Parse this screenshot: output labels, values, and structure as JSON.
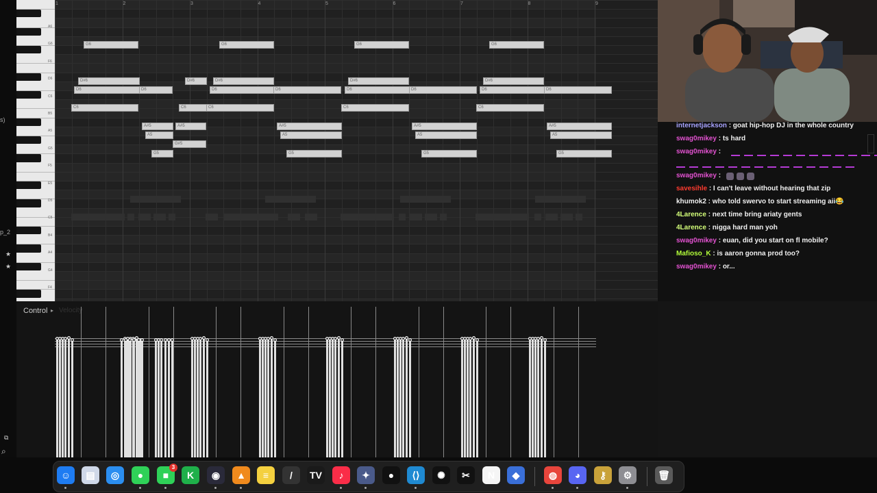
{
  "piano_roll": {
    "bar_numbers": [
      "1",
      "2",
      "3",
      "4",
      "5",
      "6",
      "7",
      "8",
      "9"
    ],
    "key_labels": [
      "A6",
      "G6",
      "F6",
      "D6",
      "C6",
      "B5",
      "A5",
      "G5",
      "F5",
      "E5",
      "D5",
      "C5",
      "B4",
      "A4",
      "G4",
      "F4",
      "E4"
    ],
    "notes": [
      {
        "label": "G6"
      },
      {
        "label": "G6"
      },
      {
        "label": "G6"
      },
      {
        "label": "G6"
      },
      {
        "label": "D#6"
      },
      {
        "label": "D#6"
      },
      {
        "label": "D#6"
      },
      {
        "label": "D#6"
      },
      {
        "label": "D#6"
      },
      {
        "label": "D6"
      },
      {
        "label": "D6"
      },
      {
        "label": "D6"
      },
      {
        "label": "D6"
      },
      {
        "label": "D6"
      },
      {
        "label": "D6"
      },
      {
        "label": "D6"
      },
      {
        "label": "D6"
      },
      {
        "label": "C6"
      },
      {
        "label": "C6"
      },
      {
        "label": "C6"
      },
      {
        "label": "C6"
      },
      {
        "label": "C6"
      },
      {
        "label": "A#5"
      },
      {
        "label": "A#5"
      },
      {
        "label": "A#5"
      },
      {
        "label": "A#5"
      },
      {
        "label": "A#5"
      },
      {
        "label": "A5"
      },
      {
        "label": "A5"
      },
      {
        "label": "A5"
      },
      {
        "label": "A5"
      },
      {
        "label": "G#5"
      },
      {
        "label": "G5"
      },
      {
        "label": "G5"
      },
      {
        "label": "G5"
      },
      {
        "label": "G5"
      }
    ]
  },
  "left_strip": {
    "label1": "s)",
    "label2": "p_2"
  },
  "control": {
    "label": "Control",
    "arrow": "▸",
    "param": "Velocity"
  },
  "chat": {
    "messages": [
      {
        "user": "internetjackson",
        "text": " : goat hip-hop DJ in the whole country",
        "color": "#a7a3ff"
      },
      {
        "user": "swag0mikey",
        "text": " : ts hard",
        "color": "#e352d1"
      },
      {
        "user": "swag0mikey",
        "text": " : ",
        "color": "#e352d1"
      },
      {
        "user": "swag0mikey",
        "text": " : ",
        "color": "#e352d1"
      },
      {
        "user": "savesihle",
        "text": " : I can't leave without hearing that zip",
        "color": "#ff3b2f"
      },
      {
        "user": "khumok2",
        "text": " : who told swervo to start streaming aii😂",
        "color": "#f0f0f0"
      },
      {
        "user": "4Larence",
        "text": " : next time bring ariaty gents",
        "color": "#d4ff7a"
      },
      {
        "user": "4Larence",
        "text": " : nigga hard man yoh",
        "color": "#d4ff7a"
      },
      {
        "user": "swag0mikey",
        "text": " : euan, did you start on fl mobile?",
        "color": "#e352d1"
      },
      {
        "user": "Mafioso_K",
        "text": " : is aaron gonna prod too?",
        "color": "#b3ff3a"
      },
      {
        "user": "swag0mikey",
        "text": " : or...",
        "color": "#e352d1"
      }
    ]
  },
  "dock": {
    "items": [
      {
        "name": "finder",
        "glyph": "☺",
        "color": "#1e7cf2"
      },
      {
        "name": "files",
        "glyph": "▤",
        "color": "#cfd8e8"
      },
      {
        "name": "safari",
        "glyph": "◎",
        "color": "#2b8ef0"
      },
      {
        "name": "messages",
        "glyph": "●",
        "color": "#2fd158"
      },
      {
        "name": "facetime",
        "glyph": "■",
        "color": "#2fd158",
        "badge": "3"
      },
      {
        "name": "keyboard-maestro",
        "glyph": "K",
        "color": "#1fb04a"
      },
      {
        "name": "obs",
        "glyph": "◉",
        "color": "#2a2a3a"
      },
      {
        "name": "fl-studio",
        "glyph": "▲",
        "color": "#f08a1d"
      },
      {
        "name": "notes",
        "glyph": "≡",
        "color": "#f4d03f"
      },
      {
        "name": "pen",
        "glyph": "/",
        "color": "#333333"
      },
      {
        "name": "tradingview",
        "glyph": "TV",
        "color": "#1a1a1a"
      },
      {
        "name": "music",
        "glyph": "♪",
        "color": "#fa2d48"
      },
      {
        "name": "davinci",
        "glyph": "✦",
        "color": "#4a5a8a"
      },
      {
        "name": "github",
        "glyph": "●",
        "color": "#111111"
      },
      {
        "name": "vscode",
        "glyph": "⟨⟩",
        "color": "#1f8ad2"
      },
      {
        "name": "chatgpt",
        "glyph": "✺",
        "color": "#111111"
      },
      {
        "name": "capcut",
        "glyph": "✂",
        "color": "#111111"
      },
      {
        "name": "notion",
        "glyph": "N",
        "color": "#f5f5f5"
      },
      {
        "name": "box-app",
        "glyph": "◆",
        "color": "#3a6fd8"
      },
      {
        "name": "chrome",
        "glyph": "◍",
        "color": "#e8453c"
      },
      {
        "name": "discord",
        "glyph": "◕",
        "color": "#5865f2"
      },
      {
        "name": "keychain",
        "glyph": "⚷",
        "color": "#c9a23a"
      },
      {
        "name": "settings",
        "glyph": "⚙",
        "color": "#8e8e93"
      },
      {
        "name": "trash",
        "glyph": "🗑",
        "color": "#5a5a5a"
      }
    ]
  }
}
